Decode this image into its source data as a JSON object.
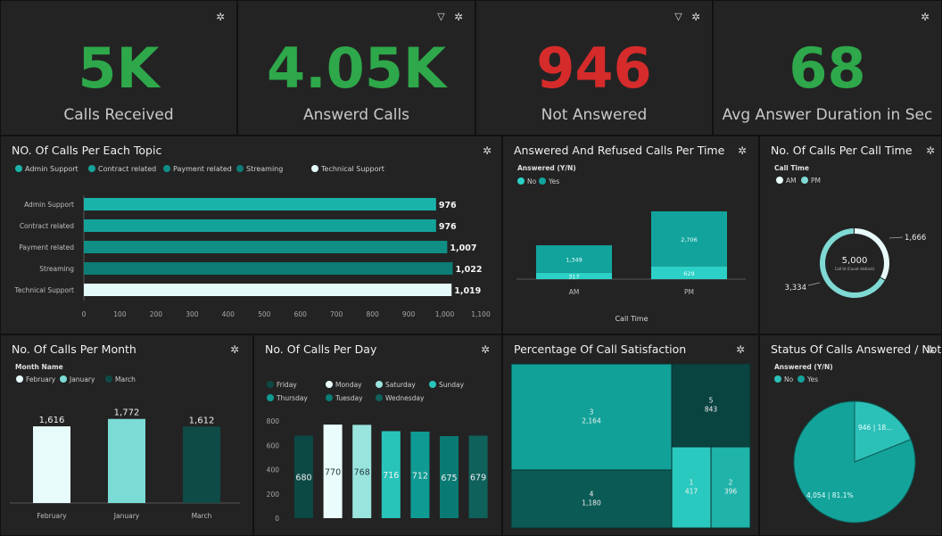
{
  "kpis": [
    {
      "value": "5K",
      "label": "Calls Received",
      "color": "#2ea84a"
    },
    {
      "value": "4.05K",
      "label": "Answerd Calls",
      "color": "#2ea84a"
    },
    {
      "value": "946",
      "label": "Not Answered",
      "color": "#d62b2b"
    },
    {
      "value": "68",
      "label": "Avg Answer Duration in Sec",
      "color": "#2ea84a"
    }
  ],
  "icons": {
    "settings": "gear-icon",
    "filter": "filter-icon"
  },
  "topic_panel": {
    "title": "NO. Of Calls Per Each Topic"
  },
  "time_panel": {
    "title": "Answered And Refused Calls  Per Time"
  },
  "calltime_panel": {
    "title": "No. Of Calls Per Call Time"
  },
  "month_panel": {
    "title": "No. Of Calls Per Month"
  },
  "day_panel": {
    "title": "No. Of Calls Per Day"
  },
  "satisfaction_panel": {
    "title": "Percentage Of Call Satisfaction"
  },
  "status_panel": {
    "title": "Status Of  Calls Answered / Not"
  },
  "chart_data": [
    {
      "id": "topic",
      "type": "bar",
      "orientation": "horizontal",
      "legend": [
        "Admin Support",
        "Contract related",
        "Payment related",
        "Streaming",
        "Technical Support"
      ],
      "categories": [
        "Admin Support",
        "Contract related",
        "Payment related",
        "Streaming",
        "Technical Support"
      ],
      "values": [
        976,
        976,
        1007,
        1022,
        1019
      ],
      "value_labels": [
        "976",
        "976",
        "1,007",
        "1,022",
        "1,019"
      ],
      "xticks": [
        "0",
        "100",
        "200",
        "300",
        "400",
        "500",
        "600",
        "700",
        "800",
        "900",
        "1,000",
        "1,100"
      ],
      "xlim": [
        0,
        1100
      ],
      "colors": [
        "#1ab3aa",
        "#13a39b",
        "#0f8e86",
        "#0c7c75",
        "#e4fbfa"
      ],
      "legend_position": "top-left"
    },
    {
      "id": "time",
      "type": "bar",
      "stacked": true,
      "legend_title": "Answered (Y/N)",
      "legend": [
        "No",
        "Yes"
      ],
      "categories": [
        "AM",
        "PM"
      ],
      "series": [
        {
          "name": "No",
          "values": [
            317,
            629
          ],
          "labels": [
            "317",
            "629"
          ],
          "color": "#2cd0c6"
        },
        {
          "name": "Yes",
          "values": [
            1349,
            2706
          ],
          "labels": [
            "1,349",
            "2,706"
          ],
          "color": "#12a49c"
        }
      ],
      "xlabel": "Call Time",
      "legend_position": "top-left"
    },
    {
      "id": "calltime",
      "type": "pie",
      "donut": true,
      "legend_title": "Call Time",
      "legend": [
        "AM",
        "PM"
      ],
      "values": [
        1666,
        3334
      ],
      "labels": [
        "1,666",
        "3,334"
      ],
      "center_value": "5,000",
      "center_label": "Call Id (Count distinct)",
      "colors": [
        "#e8fbfa",
        "#7fd9d4"
      ],
      "legend_position": "top-left"
    },
    {
      "id": "month",
      "type": "bar",
      "legend_title": "Month Name",
      "legend": [
        "February",
        "January",
        "March"
      ],
      "categories": [
        "February",
        "January",
        "March"
      ],
      "values": [
        1616,
        1772,
        1612
      ],
      "labels": [
        "1,616",
        "1,772",
        "1,612"
      ],
      "colors": [
        "#e6fbfa",
        "#7adcd5",
        "#0e4a46"
      ],
      "legend_position": "top-left"
    },
    {
      "id": "day",
      "type": "bar",
      "legend": [
        "Friday",
        "Monday",
        "Saturday",
        "Sunday",
        "Thursday",
        "Tuesday",
        "Wednesday"
      ],
      "values": [
        680,
        770,
        768,
        716,
        712,
        675,
        679
      ],
      "labels": [
        "680",
        "770",
        "768",
        "716",
        "712",
        "675",
        "679"
      ],
      "colors": [
        "#0c4844",
        "#eafcfb",
        "#9ae4de",
        "#28c4ba",
        "#0f9b93",
        "#0a7b74",
        "#0f615b"
      ],
      "yticks": [
        "0",
        "200",
        "400",
        "600",
        "800"
      ],
      "ylim": [
        0,
        800
      ],
      "legend_position": "top-left"
    },
    {
      "id": "satisfaction",
      "type": "treemap",
      "items": [
        {
          "name": "3",
          "value": "2,164",
          "color": "#12a199"
        },
        {
          "name": "4",
          "value": "1,180",
          "color": "#0c5a55"
        },
        {
          "name": "5",
          "value": "843",
          "color": "#0a4441"
        },
        {
          "name": "1",
          "value": "417",
          "color": "#2ac9bf"
        },
        {
          "name": "2",
          "value": "396",
          "color": "#1fb3aa"
        }
      ]
    },
    {
      "id": "status",
      "type": "pie",
      "legend_title": "Answered (Y/N)",
      "legend": [
        "No",
        "Yes"
      ],
      "values": [
        946,
        4054
      ],
      "labels": [
        "946 | 18...",
        "4,054 | 81.1%"
      ],
      "colors": [
        "#2cc1b8",
        "#13a39b"
      ],
      "legend_position": "top-left"
    }
  ]
}
